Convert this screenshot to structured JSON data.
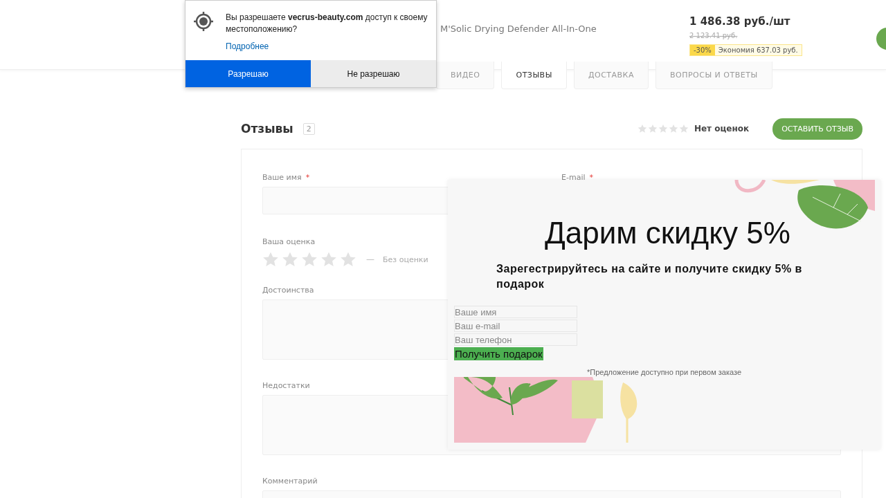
{
  "location_prompt": {
    "text": "Вы разрешаете **vecrus-beauty.com** доступ к своему местоположению?",
    "link": "Подробнее",
    "buttons": [
      {
        "label": "Разрешаю",
        "kind": "primary"
      },
      {
        "label": "Не разрешаю",
        "kind": "secondary"
      }
    ]
  },
  "product": {
    "title": "M'Solic Drying Defender All-In-One",
    "price": "1 486.38 руб./шт",
    "old_price": "2 123.41 руб.",
    "discount": "-30%",
    "savings": "Экономия 637.03 руб."
  },
  "tabs": [
    {
      "label": "ВИДЕО",
      "selected": false
    },
    {
      "label": "ОТЗЫВЫ",
      "selected": true
    },
    {
      "label": "ДОСТАВКА",
      "selected": false
    },
    {
      "label": "ВОПРОСЫ И ОТВЕТЫ",
      "selected": false
    }
  ],
  "reviews": {
    "title": "Отзывы",
    "count": "2",
    "stars": 0,
    "rating_text": "Нет оценок",
    "button": "ОСТАВИТЬ ОТЗЫВ"
  },
  "form": {
    "fields": [
      {
        "label": "Ваше имя",
        "required_mark": "*"
      },
      {
        "label": "E-mail",
        "required_mark": "*"
      }
    ],
    "rating": {
      "label": "Ваша оценка",
      "stars": 0,
      "dash": "—",
      "text": "Без оценки"
    },
    "textareas": [
      {
        "label": "Достоинства"
      },
      {
        "label": "Недостатки"
      },
      {
        "label": "Комментарий"
      }
    ]
  },
  "promo": {
    "title": "Дарим скидку 5%",
    "subtitle": "Зарегестрируйтесь на сайте и получите скидку 5% в подарок",
    "fields": [
      {
        "placeholder": "Ваше имя"
      },
      {
        "placeholder": "Ваш e-mail"
      },
      {
        "placeholder": "Ваш телефон"
      }
    ],
    "button": "Получить подарок",
    "note": "*Предложение доступно при первом заказе"
  }
}
